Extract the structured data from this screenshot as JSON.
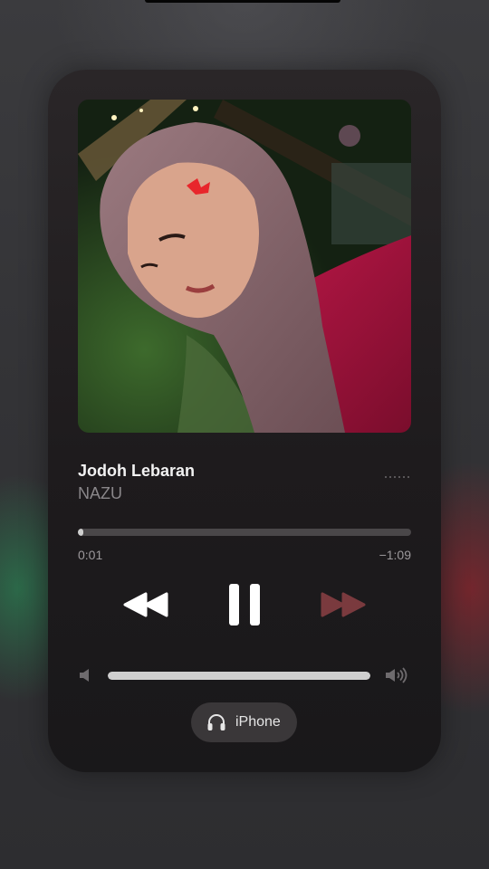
{
  "now_playing": {
    "title": "Jodoh Lebaran",
    "artist": "NAZU",
    "artwork_icon": "album-artwork-portrait"
  },
  "playback": {
    "elapsed": "0:01",
    "remaining": "−1:09",
    "progress_fraction": 0.015
  },
  "controls": {
    "previous_icon": "rewind-icon",
    "play_pause_icon": "pause-icon",
    "next_icon": "fast-forward-icon",
    "next_enabled": false
  },
  "volume": {
    "level_fraction": 1.0,
    "min_icon": "speaker-low-icon",
    "max_icon": "speaker-high-icon"
  },
  "output": {
    "device_label": "iPhone",
    "icon": "headphones-icon"
  },
  "colors": {
    "accent": "#ffffff",
    "disabled_control": "#7a3a3e",
    "secondary_text": "#8a878a"
  }
}
